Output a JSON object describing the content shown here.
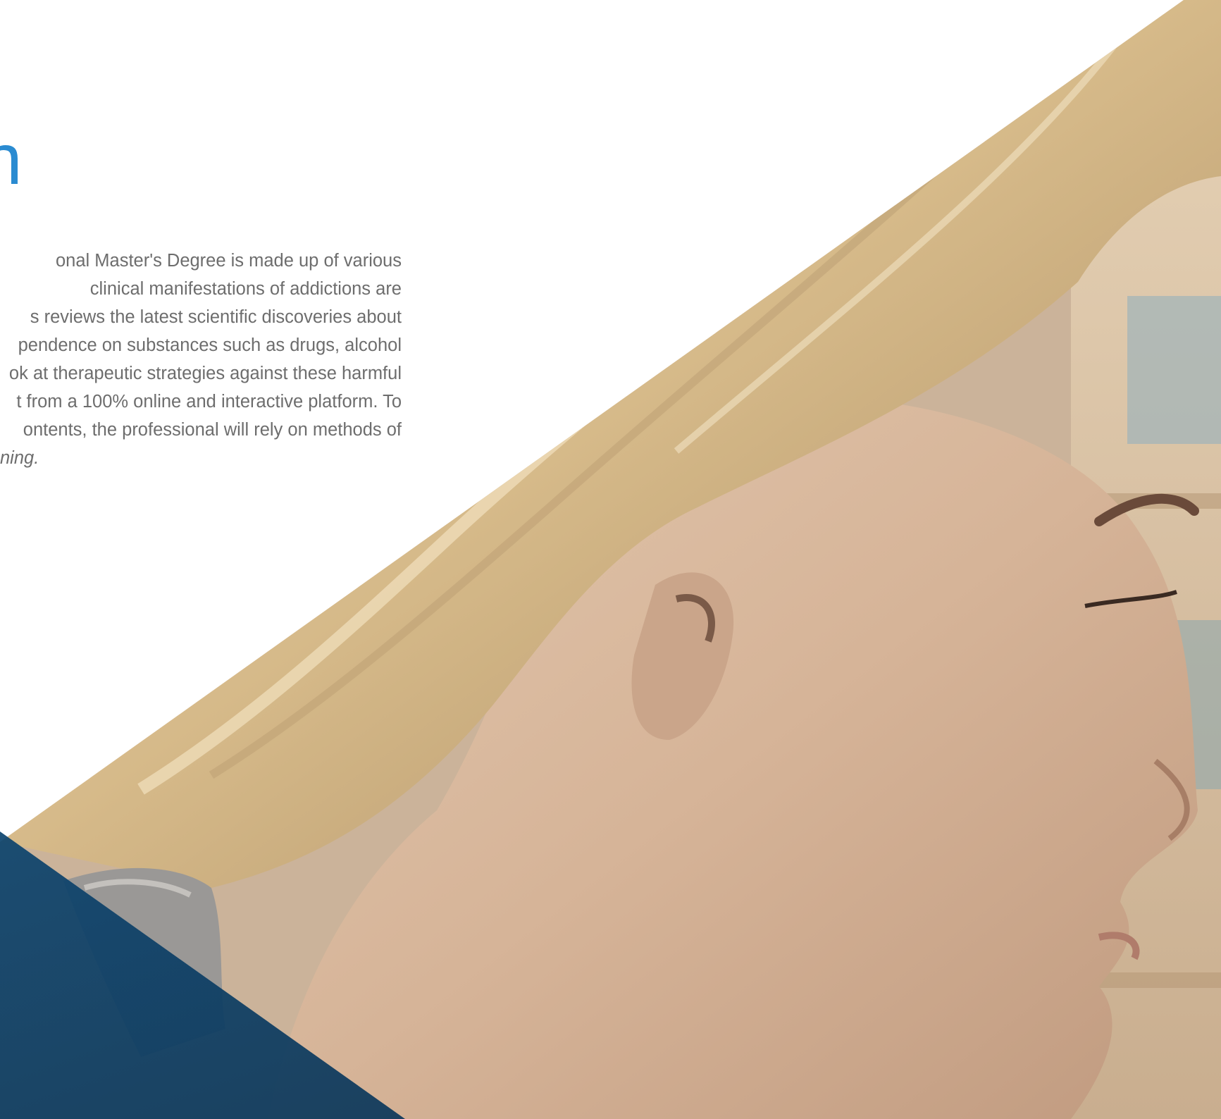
{
  "section": {
    "title": "nal Plan",
    "body_lines": [
      "onal Master's Degree is made up of various",
      "clinical manifestations of addictions are",
      "s reviews the latest scientific discoveries about",
      "pendence on substances such as drugs, alcohol",
      "ok at therapeutic strategies against these harmful",
      "t from a 100% online and interactive platform. To",
      "ontents, the professional will rely on methods of"
    ],
    "body_last_line": "ning."
  },
  "colors": {
    "title": "#2a8bd1",
    "body_text": "#6d6d6d",
    "accent_triangle": "#0c4773",
    "background": "#ffffff"
  },
  "images": {
    "hero_photo": "woman-profile-photo"
  }
}
